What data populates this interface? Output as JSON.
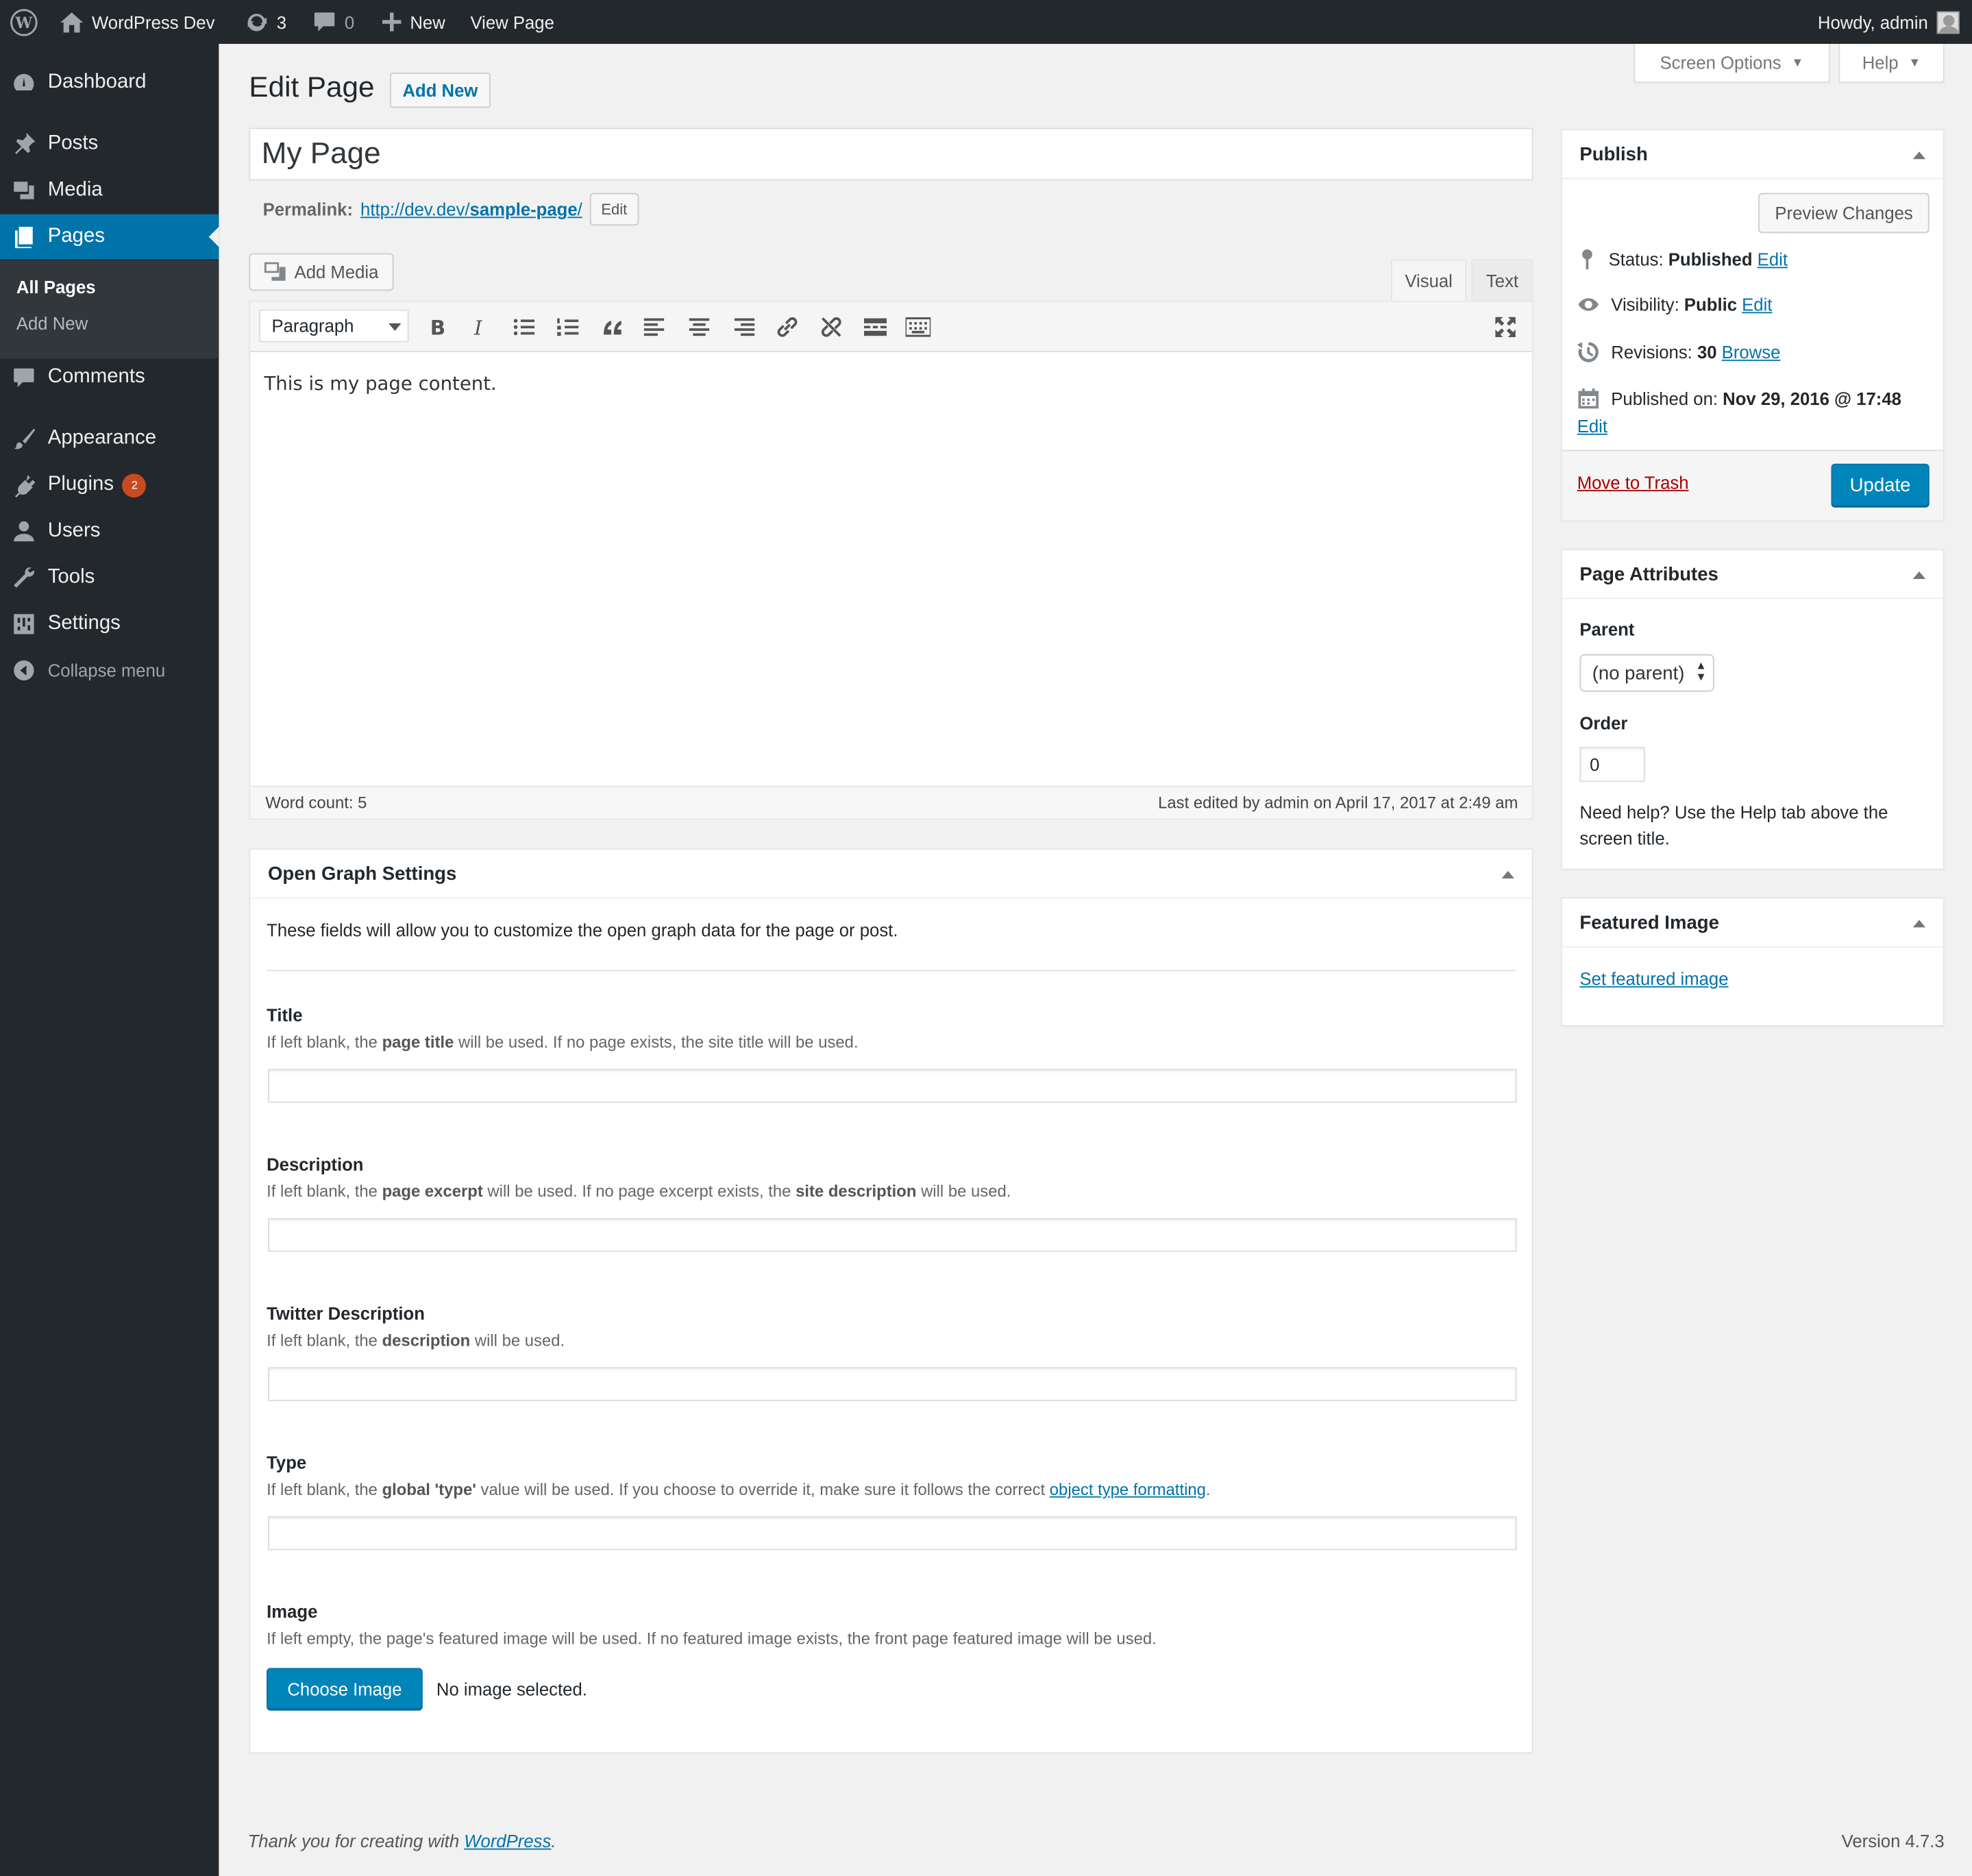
{
  "adminbar": {
    "site_name": "WordPress Dev",
    "updates_count": "3",
    "comments_count": "0",
    "new_label": "New",
    "view_page_label": "View Page",
    "howdy": "Howdy, admin"
  },
  "sidebar": {
    "items": [
      {
        "label": "Dashboard",
        "icon": "dashboard-icon"
      },
      {
        "label": "Posts",
        "icon": "pin-icon"
      },
      {
        "label": "Media",
        "icon": "media-icon"
      },
      {
        "label": "Pages",
        "icon": "pages-icon"
      },
      {
        "label": "Comments",
        "icon": "comment-icon"
      },
      {
        "label": "Appearance",
        "icon": "brush-icon"
      },
      {
        "label": "Plugins",
        "icon": "plug-icon"
      },
      {
        "label": "Users",
        "icon": "user-icon"
      },
      {
        "label": "Tools",
        "icon": "wrench-icon"
      },
      {
        "label": "Settings",
        "icon": "settings-icon"
      }
    ],
    "submenu": [
      "All Pages",
      "Add New"
    ],
    "plugins_badge": "2",
    "collapse_label": "Collapse menu"
  },
  "header": {
    "title": "Edit Page",
    "add_new": "Add New",
    "screen_options": "Screen Options",
    "help": "Help"
  },
  "post": {
    "title": "My Page",
    "permalink_label": "Permalink:",
    "permalink_prefix": "http://dev.dev/",
    "permalink_slug": "sample-page",
    "permalink_suffix": "/",
    "permalink_edit": "Edit"
  },
  "editor": {
    "add_media": "Add Media",
    "tab_visual": "Visual",
    "tab_text": "Text",
    "format": "Paragraph",
    "content": "This is my page content.",
    "word_count": "Word count: 5",
    "last_edited": "Last edited by admin on April 17, 2017 at 2:49 am"
  },
  "og": {
    "heading": "Open Graph Settings",
    "intro": "These fields will allow you to customize the open graph data for the page or post.",
    "title_label": "Title",
    "title_d1": "If left blank, the ",
    "title_d2": "page title",
    "title_d3": " will be used. If no page exists, the site title will be used.",
    "desc_label": "Description",
    "desc_d1": "If left blank, the ",
    "desc_d2": "page excerpt",
    "desc_d3": " will be used. If no page excerpt exists, the ",
    "desc_d4": "site description",
    "desc_d5": " will be used.",
    "tw_label": "Twitter Description",
    "tw_d1": "If left blank, the ",
    "tw_d2": "description",
    "tw_d3": " will be used.",
    "type_label": "Type",
    "type_d1": "If left blank, the ",
    "type_d2": "global 'type'",
    "type_d3": " value will be used. If you choose to override it, make sure it follows the correct ",
    "type_link": "object type formatting",
    "type_d4": ".",
    "image_label": "Image",
    "image_desc": "If left empty, the page's featured image will be used. If no featured image exists, the front page featured image will be used.",
    "choose_image": "Choose Image",
    "no_image": "No image selected."
  },
  "publish": {
    "heading": "Publish",
    "preview": "Preview Changes",
    "status_label": "Status: ",
    "status_value": "Published",
    "visibility_label": "Visibility: ",
    "visibility_value": "Public",
    "revisions_label": "Revisions: ",
    "revisions_value": "30",
    "browse": "Browse",
    "published_label": "Published on: ",
    "published_value": "Nov 29, 2016 @ 17:48",
    "edit": "Edit",
    "trash": "Move to Trash",
    "update": "Update"
  },
  "attributes": {
    "heading": "Page Attributes",
    "parent_label": "Parent",
    "parent_value": "(no parent)",
    "order_label": "Order",
    "order_value": "0",
    "help": "Need help? Use the Help tab above the screen title."
  },
  "featured": {
    "heading": "Featured Image",
    "link": "Set featured image"
  },
  "footer": {
    "thanks": "Thank you for creating with ",
    "wp_link": "WordPress",
    "period": ".",
    "version": "Version 4.7.3"
  }
}
